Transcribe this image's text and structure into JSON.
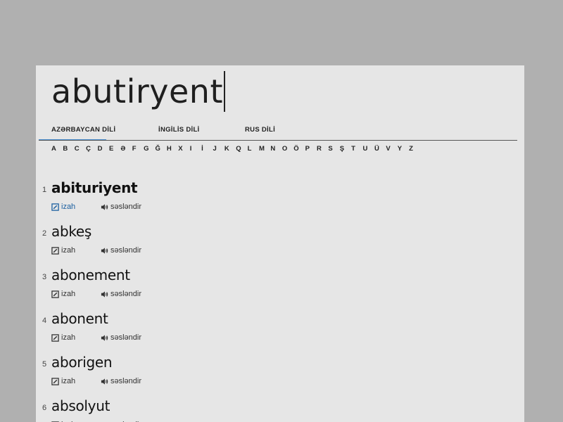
{
  "search": {
    "query": "abutiryent"
  },
  "tabs": [
    {
      "label": "AZƏRBAYCAN DİLİ",
      "active": true
    },
    {
      "label": "İNGİLİS DİLİ",
      "active": false
    },
    {
      "label": "RUS DİLİ",
      "active": false
    }
  ],
  "alphabet": [
    "A",
    "B",
    "C",
    "Ç",
    "D",
    "E",
    "Ə",
    "F",
    "G",
    "Ğ",
    "H",
    "X",
    "I",
    "İ",
    "J",
    "K",
    "Q",
    "L",
    "M",
    "N",
    "O",
    "Ö",
    "P",
    "R",
    "S",
    "Ş",
    "T",
    "U",
    "Ü",
    "V",
    "Y",
    "Z"
  ],
  "results": [
    {
      "num": "1",
      "word": "abituriyent",
      "izah": "izah",
      "sesl": "səsləndir"
    },
    {
      "num": "2",
      "word": "abkeş",
      "izah": "izah",
      "sesl": "səsləndir"
    },
    {
      "num": "3",
      "word": "abonement",
      "izah": "izah",
      "sesl": "səsləndir"
    },
    {
      "num": "4",
      "word": "abonent",
      "izah": "izah",
      "sesl": "səsləndir"
    },
    {
      "num": "5",
      "word": "aborigen",
      "izah": "izah",
      "sesl": "səsləndir"
    },
    {
      "num": "6",
      "word": "absolyut",
      "izah": "izah",
      "sesl": "səsləndir"
    }
  ],
  "colors": {
    "background": "#b0b0b0",
    "panel": "#e6e6e6",
    "accent": "#4a8fd0",
    "link_active": "#1b5fa0"
  },
  "icons": {
    "izah": "edit-box-icon",
    "sesl": "speaker-icon"
  }
}
